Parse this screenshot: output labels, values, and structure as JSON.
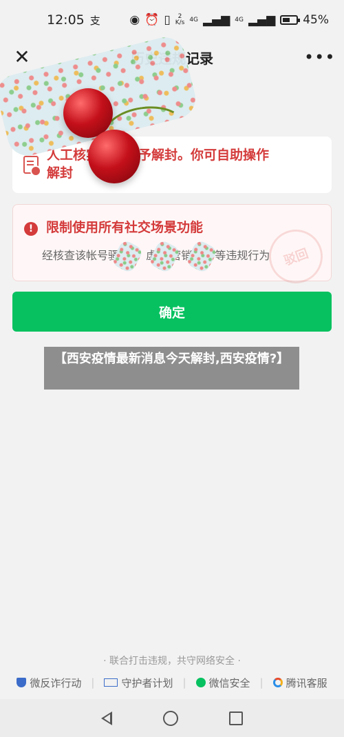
{
  "status_bar": {
    "time": "12:05",
    "alipay_glyph": "支",
    "speed_value": "2",
    "speed_unit": "K/s",
    "net1": "4G",
    "net2": "4G",
    "battery": "45%",
    "icons": [
      "eye-icon",
      "alarm-icon",
      "vibrate-icon",
      "signal-icon",
      "battery-icon"
    ]
  },
  "nav": {
    "title": "历史违规记录",
    "close_glyph": "✕",
    "more_glyph": "•••"
  },
  "notice": {
    "line1": "人工核实",
    "line1_rest": "实，不予解封。你可自助操作",
    "line2": "解封"
  },
  "restriction": {
    "title": "限制使用所有社交场景功能",
    "detail_a": "经核查该帐号骚",
    "detail_b": "虚",
    "detail_c": "营销",
    "detail_d": "诈等违规行为",
    "stamp_text": "驳回"
  },
  "confirm_button": {
    "label": "确定"
  },
  "caption": {
    "text": "【西安疫情最新消息今天解封,西安疫情?】"
  },
  "footer": {
    "slogan": "· 联合打击违规，共守网络安全 ·",
    "links": [
      {
        "label": "微反诈行动",
        "icon": "shield-icon"
      },
      {
        "label": "守护者计划",
        "icon": "guardian-icon"
      },
      {
        "label": "微信安全",
        "icon": "wechat-icon"
      },
      {
        "label": "腾讯客服",
        "icon": "tencent-icon"
      }
    ]
  },
  "colors": {
    "accent_green": "#07c160",
    "warning_red": "#d43b3b"
  }
}
